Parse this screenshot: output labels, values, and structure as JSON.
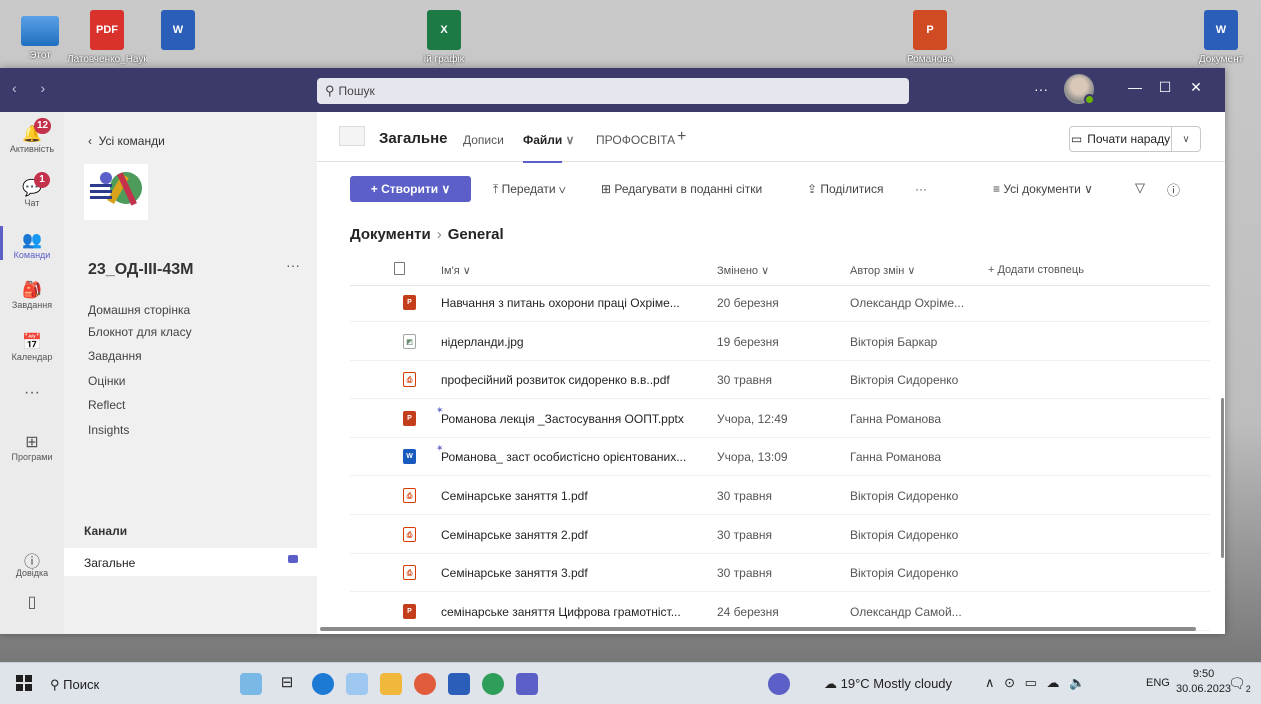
{
  "desktop": {
    "icons": [
      {
        "label": "Этот",
        "type": "pc"
      },
      {
        "label": "Латовченко_Науково-...",
        "type": "pdf",
        "badge": "PDF"
      },
      {
        "label": "",
        "type": "word",
        "badge": "W"
      },
      {
        "label": "ій графік",
        "type": "excel",
        "badge": "X"
      },
      {
        "label": "Романова",
        "type": "ppt",
        "badge": "P"
      },
      {
        "label": "Документ",
        "type": "word",
        "badge": "W"
      }
    ]
  },
  "titlebar": {
    "nav": "‹ ›",
    "search_placeholder": "Пошук",
    "more": "···",
    "minimize": "—",
    "maximize": "☐",
    "close": "✕"
  },
  "rail": [
    {
      "label": "Активність",
      "icon": "bell-icon",
      "badge": "12"
    },
    {
      "label": "Чат",
      "icon": "chat-icon",
      "badge": "1"
    },
    {
      "label": "Команди",
      "icon": "teams-icon",
      "active": true
    },
    {
      "label": "Завдання",
      "icon": "assignments-icon"
    },
    {
      "label": "Календар",
      "icon": "calendar-icon"
    },
    {
      "label": "···",
      "icon": "more-icon"
    },
    {
      "label": "Програми",
      "icon": "apps-icon"
    },
    {
      "label": "Довідка",
      "icon": "help-icon"
    }
  ],
  "team": {
    "back_label": "Усі команди",
    "name": "23_ОД-ІІІ-43М",
    "more": "···",
    "links": [
      "Домашня сторінка",
      "Блокнот для класу",
      "Завдання",
      "Оцінки",
      "Reflect",
      "Insights"
    ],
    "channels_heading": "Канали",
    "channel": "Загальне"
  },
  "channel_header": {
    "title": "Загальне",
    "tabs": [
      "Дописи",
      "Файли",
      "ПРОФОСВІТА"
    ],
    "add_tab": "+",
    "meet_label": "Почати нараду"
  },
  "toolbar": {
    "create": "+ Створити ∨",
    "upload": "⤒ Передати ∨",
    "grid_edit": "Редагувати в поданні сітки",
    "share": "Поділитися",
    "more": "···",
    "all_docs": "≡ Усі документи ∨",
    "filter": "▽",
    "info": "ⓘ"
  },
  "breadcrumb": {
    "root": "Документи",
    "current": "General"
  },
  "columns": {
    "name": "Ім'я ∨",
    "modified": "Змінено ∨",
    "author": "Автор змін ∨",
    "add": "+ Додати стовпець"
  },
  "files": [
    {
      "type": "pptx",
      "name": "Навчання з питань охорони праці Охріме...",
      "modified": "20 березня",
      "author": "Олександр Охріме...",
      "new": false
    },
    {
      "type": "jpg",
      "name": "нідерланди.jpg",
      "modified": "19 березня",
      "author": "Вікторія Баркар",
      "new": false
    },
    {
      "type": "pdf",
      "name": "професійний розвиток сидоренко в.в..pdf",
      "modified": "30 травня",
      "author": "Вікторія Сидоренко",
      "new": false
    },
    {
      "type": "pptx",
      "name": "Романова лекція _Застосування ООПТ.pptx",
      "modified": "Учора, 12:49",
      "author": "Ганна Романова",
      "new": true
    },
    {
      "type": "docx",
      "name": "Романова_ заст особистісно орієнтованих...",
      "modified": "Учора, 13:09",
      "author": "Ганна Романова",
      "new": true
    },
    {
      "type": "pdf",
      "name": "Семінарське заняття 1.pdf",
      "modified": "30 травня",
      "author": "Вікторія Сидоренко",
      "new": false
    },
    {
      "type": "pdf",
      "name": "Семінарське заняття 2.pdf",
      "modified": "30 травня",
      "author": "Вікторія Сидоренко",
      "new": false
    },
    {
      "type": "pdf",
      "name": "Семінарське заняття 3.pdf",
      "modified": "30 травня",
      "author": "Вікторія Сидоренко",
      "new": false
    },
    {
      "type": "pptx",
      "name": "семінарське заняття Цифрова грамотніст...",
      "modified": "24 березня",
      "author": "Олександр Самой...",
      "new": false
    }
  ],
  "taskbar": {
    "search": "Поиск",
    "weather": "19°C  Mostly cloudy",
    "tray": "∧ ⊙ ▭ ☁ 🔈",
    "lang": "ENG",
    "time": "9:50",
    "date": "30.06.2023",
    "notifications": "2"
  }
}
